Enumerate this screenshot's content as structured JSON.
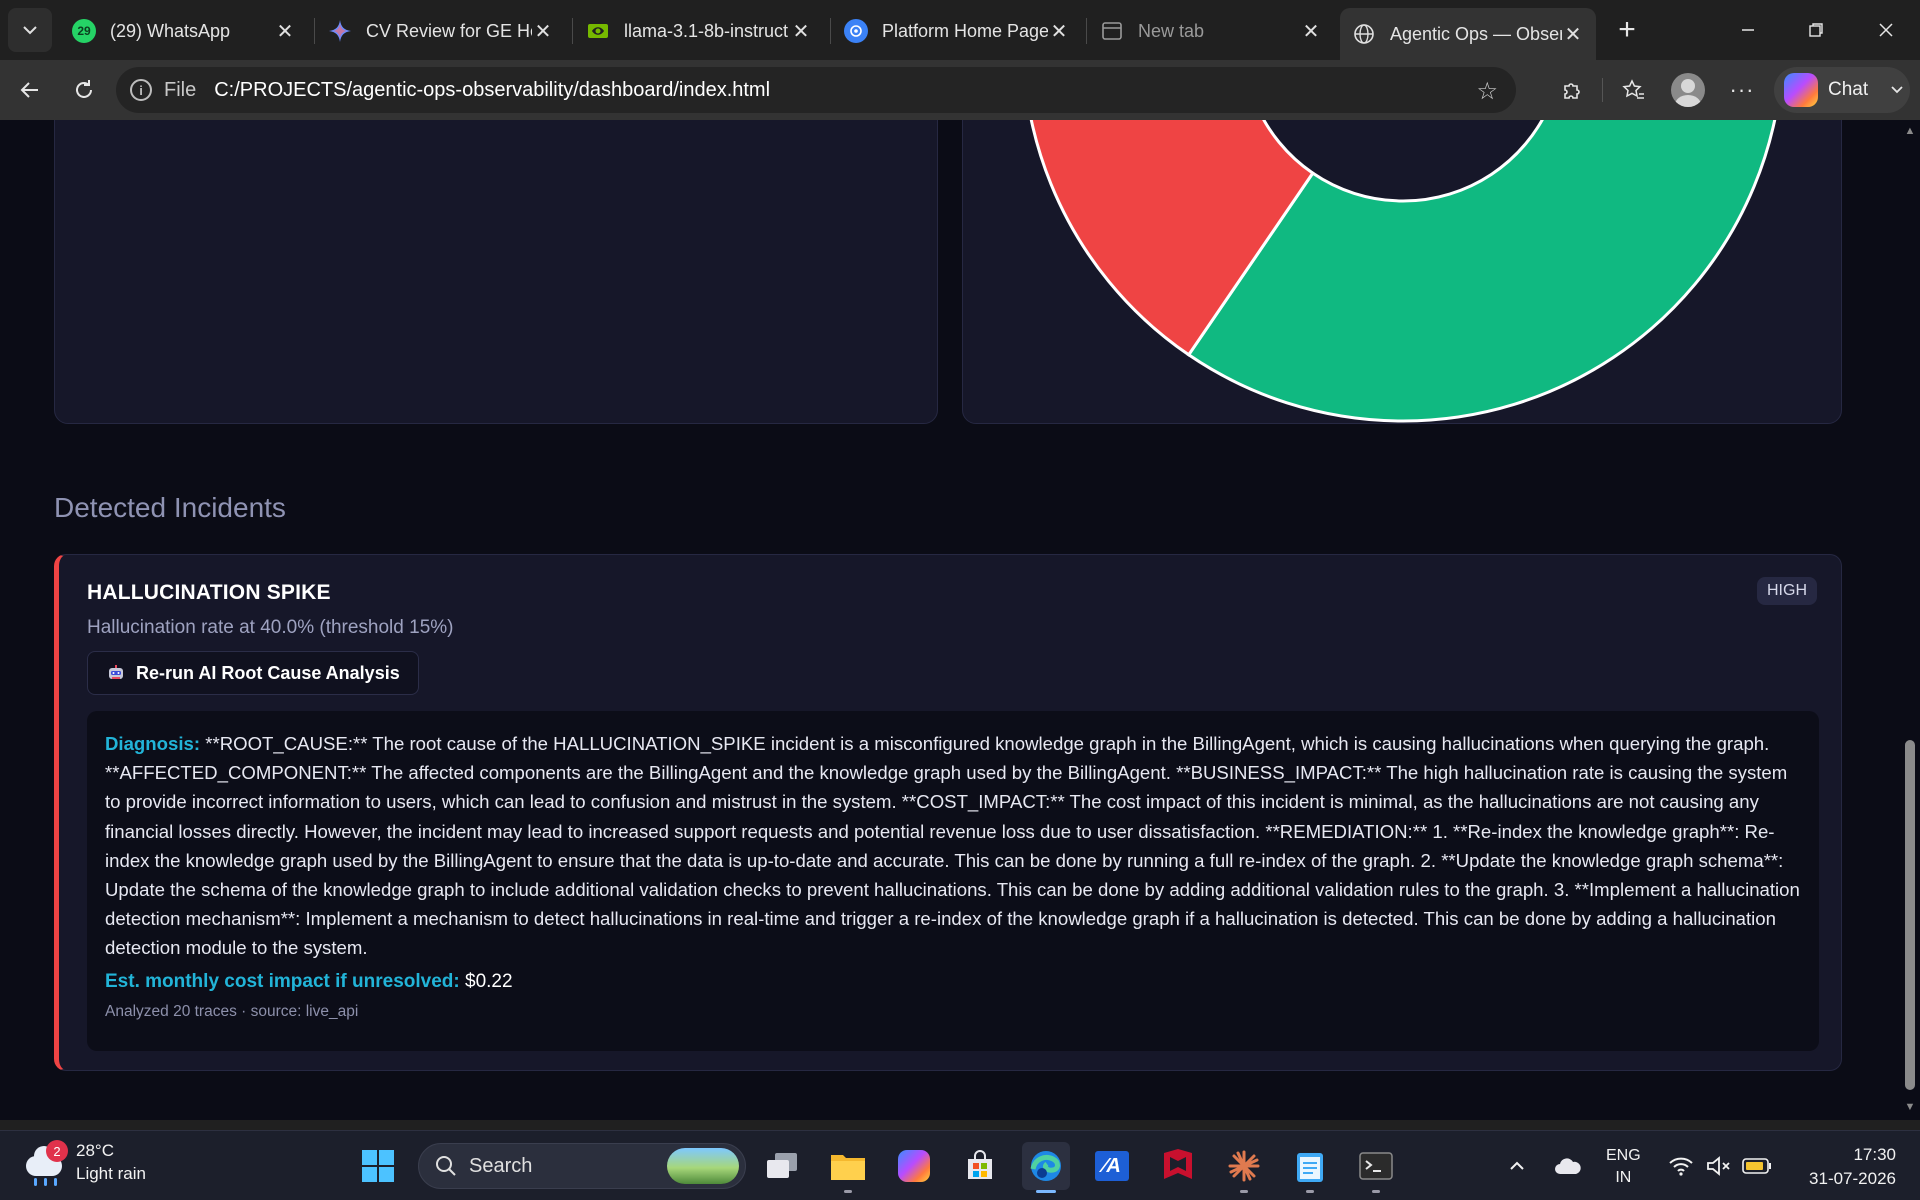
{
  "browser": {
    "tabs": [
      {
        "title": "(29) WhatsApp",
        "badge": "29",
        "favicon": "whatsapp-icon"
      },
      {
        "title": "CV Review for GE Hea",
        "favicon": "gemini-icon"
      },
      {
        "title": "llama-3.1-8b-instruct",
        "favicon": "nvidia-icon"
      },
      {
        "title": "Platform Home Page",
        "favicon": "openai-icon"
      },
      {
        "title": "New tab",
        "favicon": "new-tab-icon"
      },
      {
        "title": "Agentic Ops — Obser",
        "favicon": "globe-icon",
        "active": true
      }
    ],
    "address": {
      "scheme": "File",
      "url": "C:/PROJECTS/agentic-ops-observability/dashboard/index.html"
    },
    "chat_label": "Chat"
  },
  "page": {
    "section_heading": "Detected Incidents",
    "incident": {
      "title": "HALLUCINATION SPIKE",
      "subtitle": "Hallucination rate at 40.0% (threshold 15%)",
      "severity": "HIGH",
      "rerun_label": "Re-run AI Root Cause Analysis",
      "diagnosis_label": "Diagnosis:",
      "diagnosis_text": "**ROOT_CAUSE:** The root cause of the HALLUCINATION_SPIKE incident is a misconfigured knowledge graph in the BillingAgent, which is causing hallucinations when querying the graph. **AFFECTED_COMPONENT:** The affected components are the BillingAgent and the knowledge graph used by the BillingAgent. **BUSINESS_IMPACT:** The high hallucination rate is causing the system to provide incorrect information to users, which can lead to confusion and mistrust in the system. **COST_IMPACT:** The cost impact of this incident is minimal, as the hallucinations are not causing any financial losses directly. However, the incident may lead to increased support requests and potential revenue loss due to user dissatisfaction. **REMEDIATION:** 1. **Re-index the knowledge graph**: Re-index the knowledge graph used by the BillingAgent to ensure that the data is up-to-date and accurate. This can be done by running a full re-index of the graph. 2. **Update the knowledge graph schema**: Update the schema of the knowledge graph to include additional validation checks to prevent hallucinations. This can be done by adding additional validation rules to the graph. 3. **Implement a hallucination detection mechanism**: Implement a mechanism to detect hallucinations in real-time and trigger a re-index of the knowledge graph if a hallucination is detected. This can be done by adding a hallucination detection module to the system.",
      "cost_label": "Est. monthly cost impact if unresolved:",
      "cost_value": "$0.22",
      "meta": "Analyzed 20 traces · source: live_api"
    },
    "donut_colors": {
      "red": "#ef4444",
      "green": "#10b981"
    }
  },
  "taskbar": {
    "weather_temp": "28°C",
    "weather_desc": "Light rain",
    "weather_badge": "2",
    "search_label": "Search",
    "lang_top": "ENG",
    "lang_bottom": "IN",
    "time": "17:30",
    "date": "31-07-2026"
  }
}
